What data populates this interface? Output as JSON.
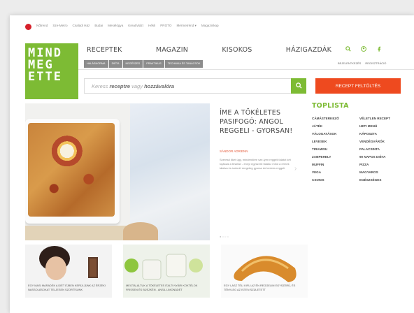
{
  "topbar": {
    "links": [
      "Nőtrend",
      "Sze-Metro",
      "Családi Ház",
      "Budai",
      "Mesélógya",
      "Kreatívlázt",
      "Hékli",
      "PROTO",
      "Mérmetrénd ▾",
      "Magazinkap"
    ]
  },
  "logo": {
    "lines": [
      "MIND",
      "MEG",
      "ETTE"
    ]
  },
  "nav": {
    "items": [
      "RECEPTEK",
      "MAGAZIN",
      "KISOKOS",
      "HÁZIGAZDÁK"
    ],
    "icons": [
      "search-icon",
      "user-icon",
      "facebook-icon"
    ]
  },
  "subnav": {
    "items": [
      "HALÁSNORMA",
      "DIÉTA",
      "NEGÉSZES",
      "PRAKTIKUS",
      "TECHNIKA ÉS TANÁCSOK"
    ]
  },
  "login": {
    "items": [
      "BEJELENTKEZÉS",
      "REGISZTRÁCIÓ"
    ]
  },
  "search": {
    "placeholder_prefix": "Keress",
    "placeholder_b1": "receptre",
    "placeholder_mid": "vagy",
    "placeholder_b2": "hozzávalóra",
    "button_icon": "search-icon",
    "upload_label": "RECEPT FELTÖLTÉS"
  },
  "hero": {
    "title": "ÍME A TÖKÉLETES PASIFOGÓ: ANGOL REGGELI - GYORSAN!",
    "author": "SÁNDOR ADRIENN",
    "description": "Szeresd őket úgy, mindentörre sze-lyen reggeli falatot két tojással a tésztán - ennyi egyszerű falatoz mind a remek tálalva és ízeknél rengeteg gyorsa én kedves reggeli.",
    "dots": "● ○ ○ ○"
  },
  "toplista": {
    "title": "TOPLISTA",
    "col1": [
      "CÁMÁSTERKEZŐ",
      "JÁTÉK",
      "VÁLOGATÁSOK",
      "LEVESEK",
      "TIRAMISU",
      "ZABPEHELY",
      "MUFFIN",
      "VEGA",
      "CSOKIS"
    ],
    "col2": [
      "VÉLETLEN RECEPT",
      "HETI MENÜ",
      "KÁPOSZTA",
      "VENDÉGVÁRÓK",
      "PALACSINTA",
      "90 NAPOS DIÉTA",
      "PIZZA",
      "MAGYAROS",
      "EGÉSZSÉGES"
    ]
  },
  "cards": [
    {
      "caption": "EGY MASI MARADÉK A DIÉT ÉJBEN KERÜLJÜNK AZ ÉRZEKI NASSOLÁSOKAT TELJESEN SZORÍTSUNK"
    },
    {
      "caption": "MEGTALÁLTUK A TÖKÉLETES ITALT! NYÁRI KOKTÉLOK FRISSEN ÉS BÜSZKÉN - ANSIL LIMONÁDÉT"
    },
    {
      "caption": "EGY LASZ TÉLI KIFLI AZ ÉN REGGELIM EGYSZERŰ, ÉS TÉNYLEG AZ ISTEN SZÜLETETT"
    }
  ],
  "colors": {
    "green": "#7dbb34",
    "orange": "#ee4a1f",
    "red": "#d6202a"
  }
}
